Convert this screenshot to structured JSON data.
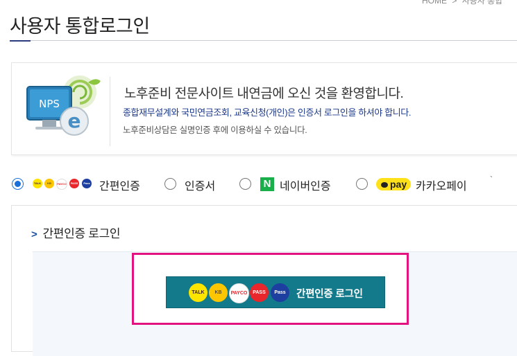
{
  "breadcrumb": {
    "home": "HOME",
    "separator": ">",
    "current": "사용자 통합"
  },
  "page": {
    "title": "사용자 통합로그인"
  },
  "welcome": {
    "logo_text": "NPS",
    "heading": "노후준비 전문사이트 내연금에 오신 것을 환영합니다.",
    "subtext": "종합재무설계와 국민연금조회, 교육신청(개인)은 인증서 로그인을 하셔야 합니다.",
    "note": "노후준비상담은 실명인증 후에 이용하실 수 있습니다."
  },
  "auth_options": {
    "selected": "simple",
    "items": [
      {
        "id": "simple",
        "label": "간편인증"
      },
      {
        "id": "certificate",
        "label": "인증서"
      },
      {
        "id": "naver",
        "label": "네이버인증",
        "icon_text": "N"
      },
      {
        "id": "kakaopay",
        "label": "카카오페이",
        "icon_text": "pay"
      }
    ],
    "mini_icons": [
      {
        "name": "kakaotalk",
        "text": "TALK",
        "bg": "#fde500",
        "fg": "#3b1e1e"
      },
      {
        "name": "kb",
        "text": "KB",
        "bg": "#fdc600",
        "fg": "#5a4a2a"
      },
      {
        "name": "payco",
        "text": "PAYCO",
        "bg": "#ffffff",
        "fg": "#e8262b"
      },
      {
        "name": "pass",
        "text": "PASS",
        "bg": "#e8262b",
        "fg": "#ffffff"
      },
      {
        "name": "samsung-pass",
        "text": "Pass",
        "bg": "#1d3fa0",
        "fg": "#ffffff"
      }
    ]
  },
  "login_section": {
    "title": "간편인증 로그인",
    "button_label": "간편인증 로그인",
    "icons": [
      {
        "name": "kakaotalk",
        "text": "TALK",
        "bg": "#fde500",
        "fg": "#3b1e1e"
      },
      {
        "name": "kb",
        "text": "KB",
        "bg": "#fdc600",
        "fg": "#5a4a2a"
      },
      {
        "name": "payco",
        "text": "PAYCO",
        "bg": "#ffffff",
        "fg": "#e8262b"
      },
      {
        "name": "pass",
        "text": "PASS",
        "bg": "#e8262b",
        "fg": "#ffffff"
      },
      {
        "name": "samsung-pass",
        "text": "Pass",
        "bg": "#1d3fa0",
        "fg": "#ffffff"
      }
    ]
  },
  "colors": {
    "accent": "#1a6fd8",
    "button": "#127a8a",
    "highlight": "#e2137f",
    "title_line": "#2a3a7c"
  }
}
